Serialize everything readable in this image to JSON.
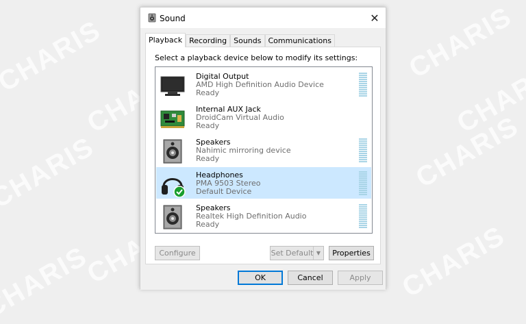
{
  "watermark": {
    "text": "CHARIS"
  },
  "window": {
    "title": "Sound",
    "close_glyph": "✕"
  },
  "tabs": [
    {
      "label": "Playback",
      "active": true
    },
    {
      "label": "Recording",
      "active": false
    },
    {
      "label": "Sounds",
      "active": false
    },
    {
      "label": "Communications",
      "active": false
    }
  ],
  "instruction": "Select a playback device below to modify its settings:",
  "devices": [
    {
      "name": "Digital Output",
      "description": "AMD High Definition Audio Device",
      "status": "Ready",
      "icon": "monitor-icon",
      "selected": false,
      "default": false
    },
    {
      "name": "Internal AUX Jack",
      "description": "DroidCam Virtual Audio",
      "status": "Ready",
      "icon": "circuit-board-icon",
      "selected": false,
      "default": false
    },
    {
      "name": "Speakers",
      "description": "Nahimic mirroring device",
      "status": "Ready",
      "icon": "speaker-icon",
      "selected": false,
      "default": false
    },
    {
      "name": "Headphones",
      "description": "PMA 9503 Stereo",
      "status": "Default Device",
      "icon": "headphones-icon",
      "selected": true,
      "default": true
    },
    {
      "name": "Speakers",
      "description": "Realtek High Definition Audio",
      "status": "Ready",
      "icon": "speaker-icon",
      "selected": false,
      "default": false
    }
  ],
  "buttons": {
    "configure": "Configure",
    "set_default": "Set Default",
    "properties": "Properties",
    "ok": "OK",
    "cancel": "Cancel",
    "apply": "Apply"
  },
  "colors": {
    "selection": "#cce8ff",
    "focus_border": "#0078d7",
    "default_badge": "#1a9e2e"
  }
}
